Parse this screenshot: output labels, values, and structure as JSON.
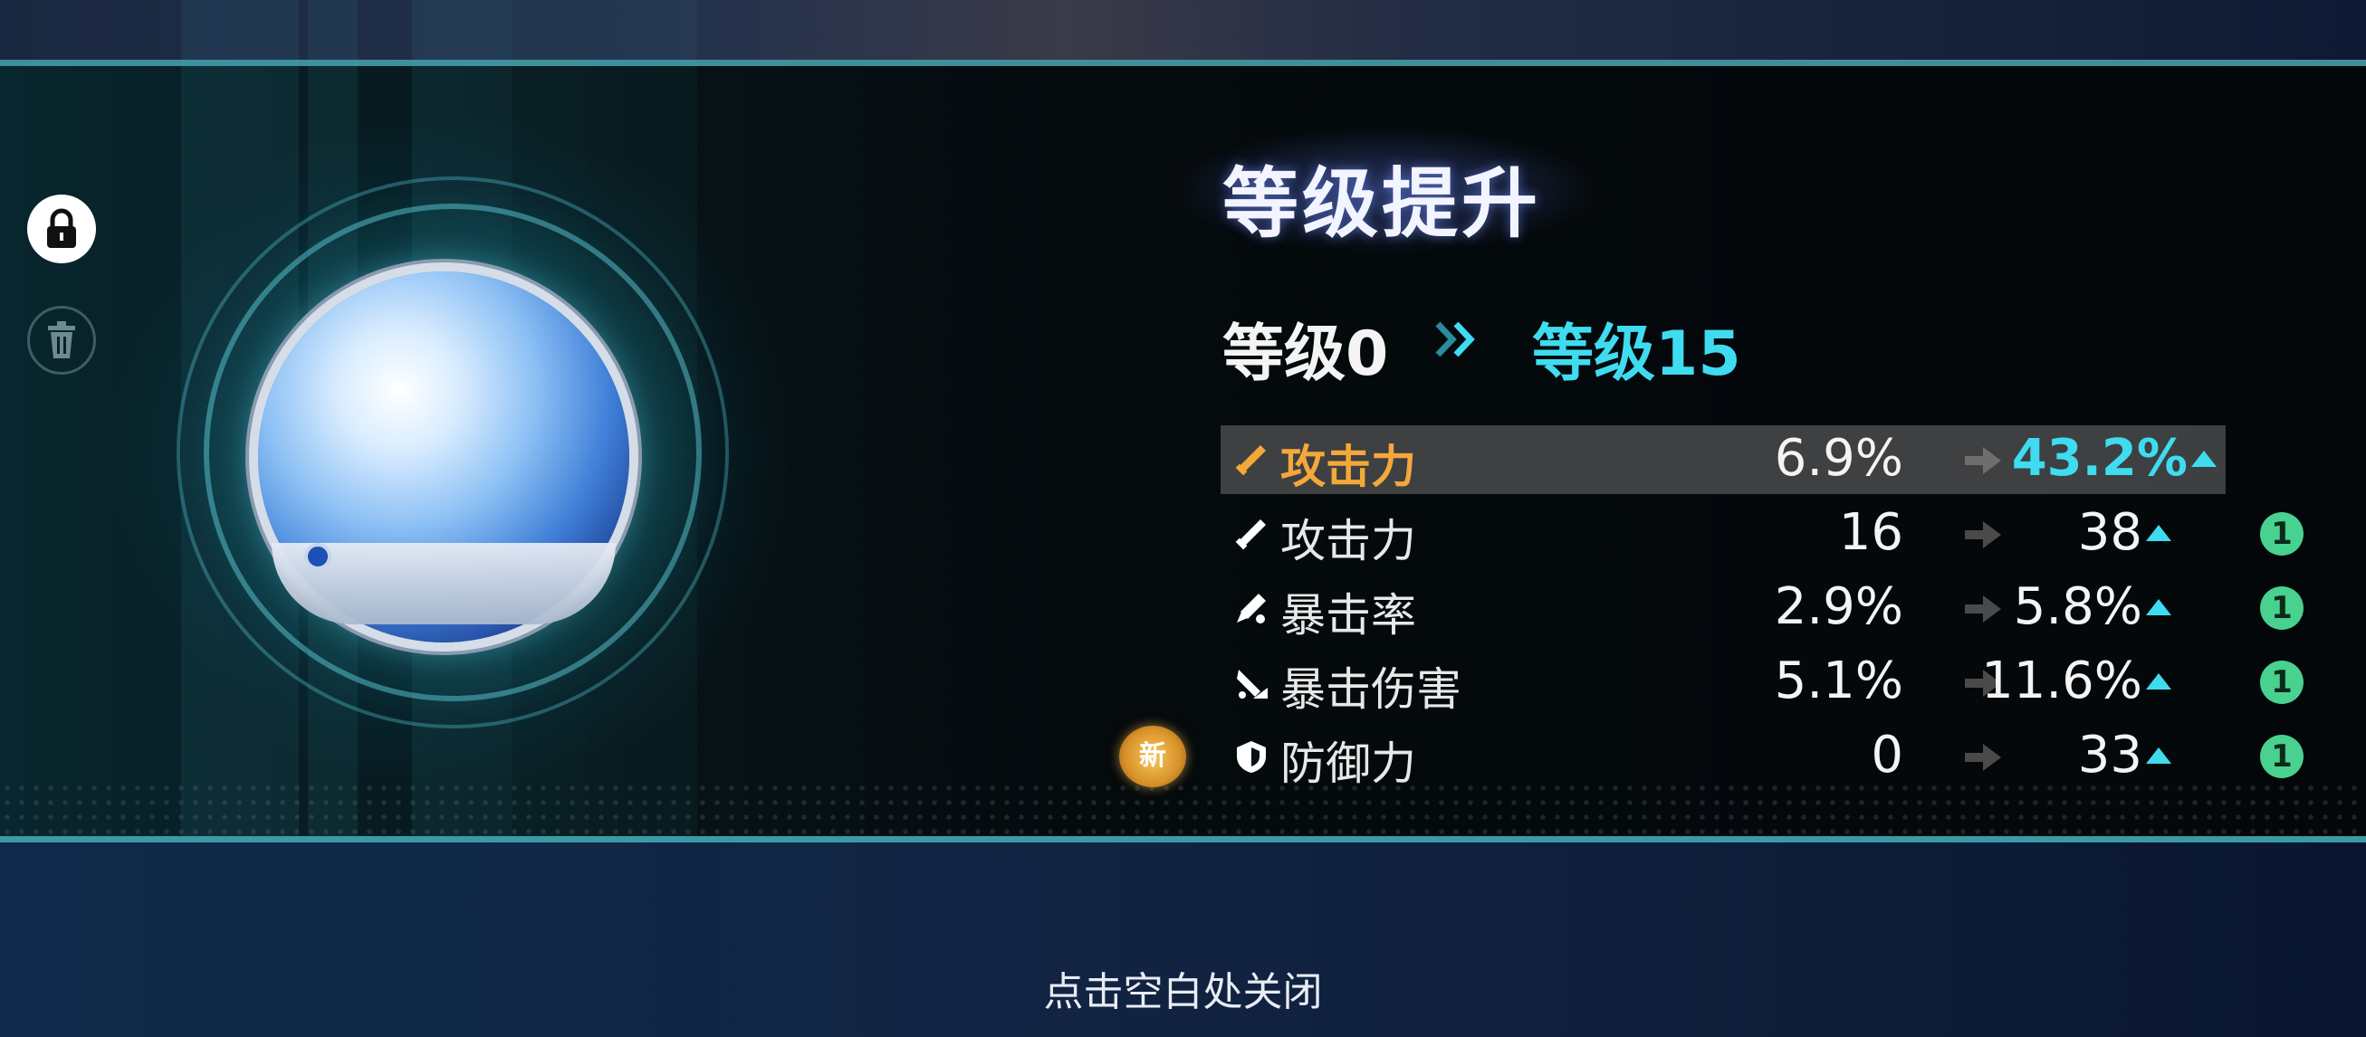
{
  "panel": {
    "title": "等级提升",
    "level_from": "等级0",
    "level_to": "等级15"
  },
  "main_stat": {
    "name": "攻击力",
    "old": "6.9%",
    "new": "43.2%"
  },
  "sub_stats": [
    {
      "name": "攻击力",
      "old": "16",
      "new": "38",
      "rolls": "1",
      "icon": "sword-icon"
    },
    {
      "name": "暴击率",
      "old": "2.9%",
      "new": "5.8%",
      "rolls": "1",
      "icon": "crit-rate-icon"
    },
    {
      "name": "暴击伤害",
      "old": "5.1%",
      "new": "11.6%",
      "rolls": "1",
      "icon": "crit-damage-icon"
    },
    {
      "name": "防御力",
      "old": "0",
      "new": "33",
      "rolls": "1",
      "icon": "shield-icon",
      "is_new": true
    }
  ],
  "new_badge_label": "新",
  "close_hint": "点击空白处关闭",
  "colors": {
    "accent_cyan": "#3fdcf0",
    "main_stat_orange": "#f4a83a",
    "roll_badge_green": "#49d18f",
    "divider_teal": "#3f8f9a"
  }
}
